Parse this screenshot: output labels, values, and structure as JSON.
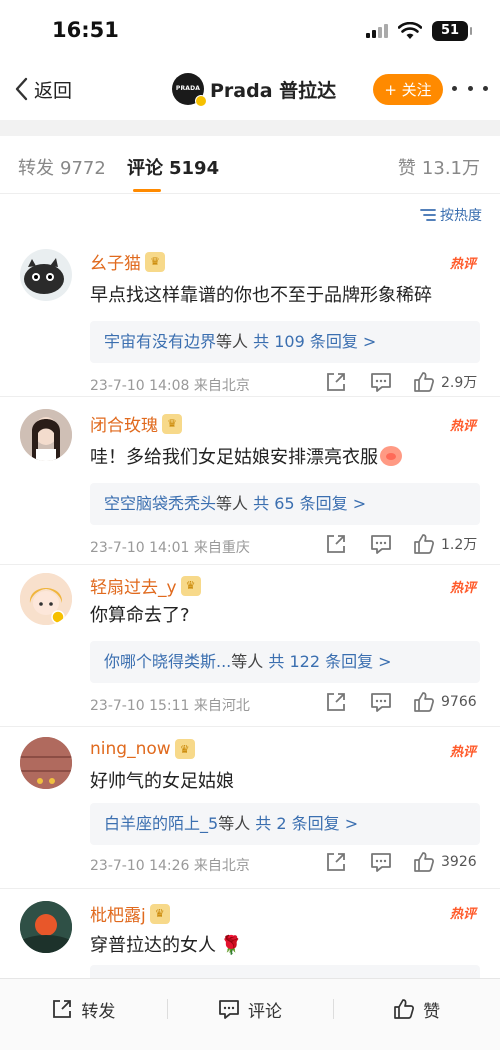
{
  "status_bar": {
    "time": "16:51",
    "battery": "51"
  },
  "nav": {
    "back_label": "返回",
    "avatar_text": "PRADA",
    "title": "Prada 普拉达",
    "follow_label": "+ 关注"
  },
  "tabs": {
    "repost_label": "转发",
    "repost_count": "9772",
    "comment_label": "评论",
    "comment_count": "5194",
    "like_label": "赞",
    "like_count": "13.1万"
  },
  "sort_label": "按热度",
  "hot_label": "热评",
  "comments": [
    {
      "user": "幺子猫",
      "text": "早点找这样靠谱的你也不至于品牌形象稀碎",
      "reply_name": "宇宙有没有边界",
      "reply_mid": "等人",
      "reply_count": "共 109 条回复 >",
      "date": "23-7-10 14:08",
      "location": "来自北京",
      "likes": "2.9万"
    },
    {
      "user": "闭合玫瑰",
      "text": "哇！多给我们女足姑娘安排漂亮衣服",
      "reply_name": "空空脑袋秃秃头",
      "reply_mid": "等人",
      "reply_count": "共 65 条回复 >",
      "date": "23-7-10 14:01",
      "location": "来自重庆",
      "likes": "1.2万"
    },
    {
      "user": "轻扇过去_y",
      "text": "你算命去了?",
      "reply_name": "你哪个晓得类斯...",
      "reply_mid": "等人",
      "reply_count": "共 122 条回复 >",
      "date": "23-7-10 15:11",
      "location": "来自河北",
      "likes": "9766"
    },
    {
      "user": "ning_now",
      "text": "好帅气的女足姑娘",
      "reply_name": "白羊座的陌上_5",
      "reply_mid": "等人",
      "reply_count": "共 2 条回复 >",
      "date": "23-7-10 14:26",
      "location": "来自北京",
      "likes": "3926"
    },
    {
      "user": "枇杷露j",
      "text": "穿普拉达的女人",
      "reply_name": "",
      "reply_mid": "",
      "reply_count": "",
      "date": "",
      "location": "",
      "likes": ""
    }
  ],
  "bottom_bar": {
    "repost": "转发",
    "comment": "评论",
    "like": "赞"
  },
  "colors": {
    "accent": "#ff8a00",
    "username": "#e06a1e",
    "link": "#3b6fb0",
    "hot": "#ff5a2a"
  }
}
